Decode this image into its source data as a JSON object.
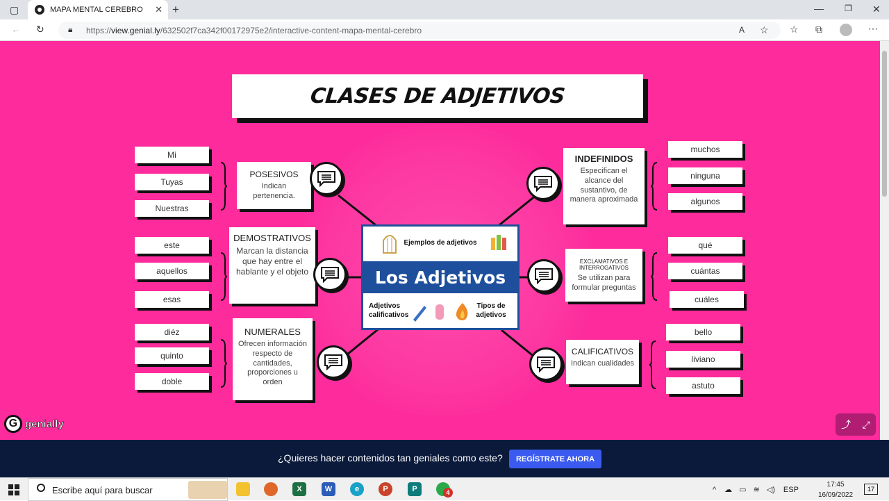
{
  "browser": {
    "tab_title": "MAPA MENTAL CEREBRO",
    "url_prefix": "https://",
    "url_domain": "view.genial.ly",
    "url_rest": "/632502f7ca342f00172975e2/interactive-content-mapa-mental-cerebro"
  },
  "title": "CLASES DE ADJETIVOS",
  "center_image": {
    "top_label": "Ejemplos de adjetivos",
    "main_label": "Los Adjetivos",
    "left_label": "Adjetivos calificativos",
    "right_label": "Tipos de adjetivos"
  },
  "categories": {
    "posesivos": {
      "heading": "POSESIVOS",
      "desc": "Indican pertenencia.",
      "examples": [
        "Mi",
        "Tuyas",
        "Nuestras"
      ]
    },
    "demostrativos": {
      "heading": "DEMOSTRATIVOS",
      "desc": "Marcan la distancia que hay entre el hablante y el objeto",
      "examples": [
        "este",
        "aquellos",
        "esas"
      ]
    },
    "numerales": {
      "heading": "NUMERALES",
      "desc": "Ofrecen información respecto de cantidades, proporciones u orden",
      "examples": [
        "diéz",
        "quinto",
        "doble"
      ]
    },
    "indefinidos": {
      "heading": "INDEFINIDOS",
      "desc": "Especifican el alcance del sustantivo, de manera aproximada",
      "examples": [
        "muchos",
        "ninguna",
        "algunos"
      ]
    },
    "exclamativos": {
      "heading": "EXCLAMATIVOS E INTERROGATIVOS",
      "desc": "Se utilizan para formular preguntas",
      "examples": [
        "qué",
        "cuántas",
        "cuáles"
      ]
    },
    "calificativos": {
      "heading": "CALIFICATIVOS",
      "desc": "Indican cualidades",
      "examples": [
        "bello",
        "liviano",
        "astuto"
      ]
    }
  },
  "genially_brand": "genially",
  "banner": {
    "question": "¿Quieres hacer contenidos tan geniales como este?",
    "cta": "REGÍSTRATE AHORA"
  },
  "taskbar": {
    "search_placeholder": "Escribe aquí para buscar",
    "language": "ESP",
    "time": "17:45",
    "date": "16/09/2022",
    "notification_count": "17",
    "mail_badge": "4"
  },
  "colors": {
    "page_bg": "#fd2b9c",
    "center_blue": "#1e4f9c",
    "banner_bg": "#0b1a3b",
    "cta_bg": "#3b5bf0"
  }
}
